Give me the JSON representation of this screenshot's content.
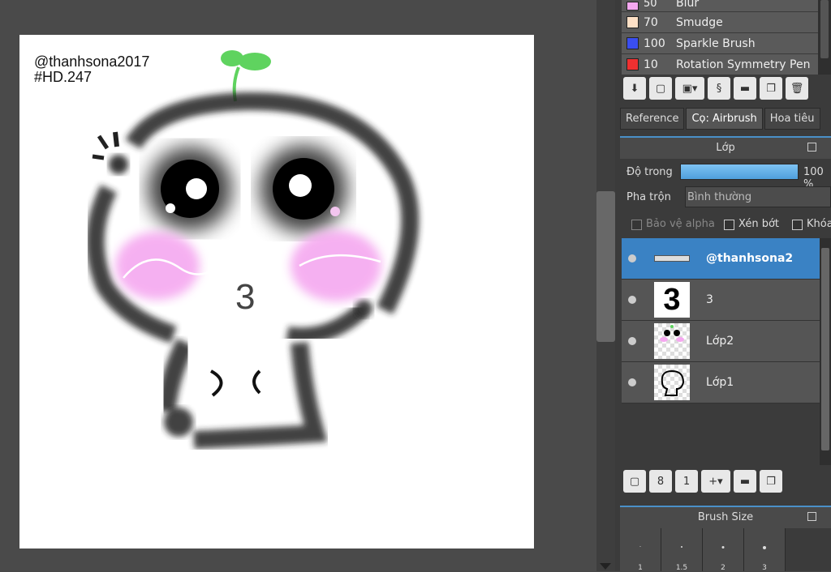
{
  "canvas": {
    "signature_line1": "@thanhsona2017",
    "signature_line2": "#HD.247",
    "number_on_face": "3"
  },
  "brushes": [
    {
      "size": "50",
      "name": "Blur",
      "color": "#f5a8f0"
    },
    {
      "size": "70",
      "name": "Smudge",
      "color": "#fde0c6"
    },
    {
      "size": "100",
      "name": "Sparkle Brush",
      "color": "#3a4ef0"
    },
    {
      "size": "10",
      "name": "Rotation Symmetry Pen",
      "color": "#f03030"
    }
  ],
  "tabs": [
    "Reference",
    "Cọ: Airbrush",
    "Hoa tiêu"
  ],
  "layer_panel": {
    "title": "Lớp",
    "opacity_label": "Độ trong",
    "opacity_value": "100 %",
    "blend_label": "Pha trộn",
    "blend_value": "Bình thường",
    "protect_alpha": "Bảo vệ alpha",
    "clipping": "Xén bớt",
    "lock": "Khóa"
  },
  "layers": [
    {
      "name": "@thanhsona2",
      "selected": true
    },
    {
      "name": "3",
      "selected": false
    },
    {
      "name": "Lớp2",
      "selected": false
    },
    {
      "name": "Lớp1",
      "selected": false
    }
  ],
  "brush_size": {
    "title": "Brush Size",
    "sizes": [
      "1",
      "1.5",
      "2",
      "3"
    ]
  }
}
